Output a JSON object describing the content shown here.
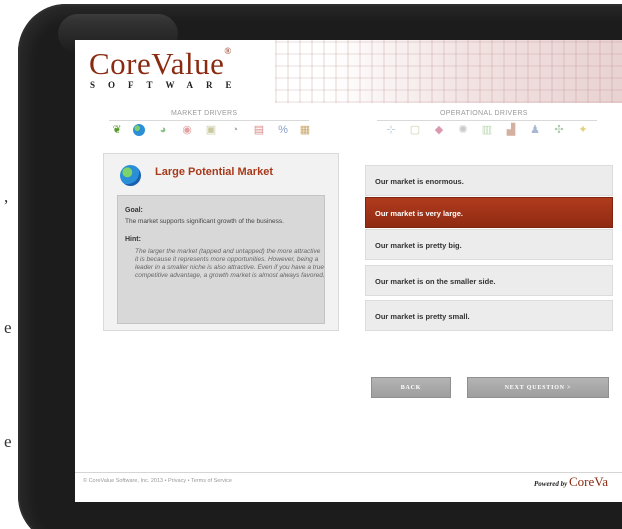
{
  "edge_text": [
    ",",
    "e",
    "e"
  ],
  "app": {
    "logo_main": "CoreValue",
    "logo_trademark": "®",
    "logo_sub": "SOFTWARE"
  },
  "drivers": {
    "market_label": "MARKET DRIVERS",
    "operational_label": "OPERATIONAL DRIVERS",
    "market_icons": [
      "plant-icon",
      "globe-icon",
      "pie-chart-icon",
      "target-icon",
      "lock-icon",
      "clock-icon",
      "calendar-icon",
      "percent-icon",
      "grid-chart-icon"
    ],
    "operational_icons": [
      "process-icon",
      "document-icon",
      "tag-icon",
      "gear-icon",
      "clipboard-icon",
      "factory-icon",
      "people-icon",
      "network-icon",
      "lightbulb-icon"
    ]
  },
  "question": {
    "title": "Large Potential Market",
    "goal_label": "Goal:",
    "goal_text": "The market supports significant growth of the business.",
    "hint_label": "Hint:",
    "hint_text": "The larger the market (tapped and untapped) the more attractive it is because it represents more opportunities. However, being a leader in a smaller niche is also attractive. Even if you have a true competitive advantage, a growth market is almost always favored."
  },
  "answers": [
    {
      "label": "Our market is enormous.",
      "selected": false
    },
    {
      "label": "Our market is very large.",
      "selected": true
    },
    {
      "label": "Our market is pretty big.",
      "selected": false
    },
    {
      "label": "Our market is on the smaller side.",
      "selected": false
    },
    {
      "label": "Our market is pretty small.",
      "selected": false
    }
  ],
  "buttons": {
    "back": "BACK",
    "next": "NEXT QUESTION >"
  },
  "footer": {
    "copyright": "© CoreValue Software, Inc. 2013 • Privacy • Terms of Service",
    "powered_by": "Powered by",
    "brand": "CoreVa"
  },
  "colors": {
    "accent": "#9a3216",
    "selected_answer": "#a3361a"
  }
}
